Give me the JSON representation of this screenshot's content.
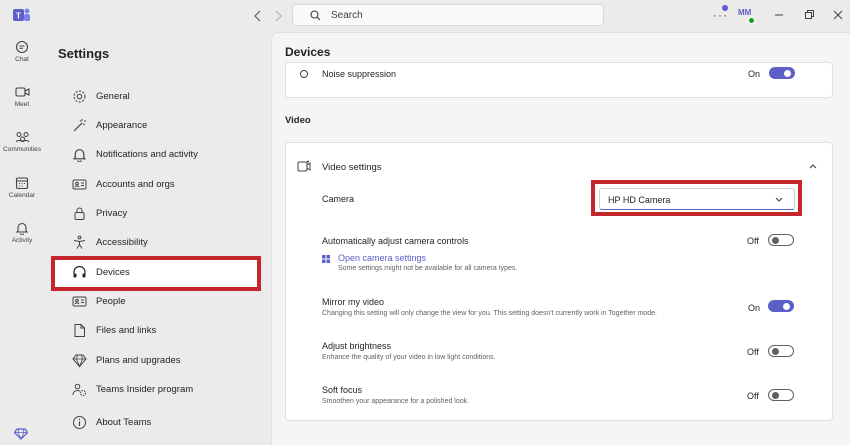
{
  "app": {
    "title": "Microsoft Teams",
    "accent": "#5b5fc7",
    "highlight": "#c4262e"
  },
  "rail": {
    "items": [
      {
        "label": "Chat",
        "icon": "chat-icon"
      },
      {
        "label": "Meet",
        "icon": "video-icon"
      },
      {
        "label": "Communities",
        "icon": "communities-icon"
      },
      {
        "label": "Calendar",
        "icon": "calendar-icon"
      },
      {
        "label": "Activity",
        "icon": "bell-icon"
      }
    ]
  },
  "titlebar": {
    "search_placeholder": "Search",
    "avatar_initials": "MM",
    "more_label": "···"
  },
  "settings": {
    "title": "Settings",
    "items": [
      {
        "label": "General",
        "icon": "gear-icon"
      },
      {
        "label": "Appearance",
        "icon": "wand-icon"
      },
      {
        "label": "Notifications and activity",
        "icon": "bell-icon"
      },
      {
        "label": "Accounts and orgs",
        "icon": "id-card-icon"
      },
      {
        "label": "Privacy",
        "icon": "lock-icon"
      },
      {
        "label": "Accessibility",
        "icon": "accessibility-icon"
      },
      {
        "label": "Devices",
        "icon": "headset-icon",
        "selected": true
      },
      {
        "label": "People",
        "icon": "contact-card-icon"
      },
      {
        "label": "Files and links",
        "icon": "file-icon"
      },
      {
        "label": "Plans and upgrades",
        "icon": "diamond-icon"
      },
      {
        "label": "Teams Insider program",
        "icon": "people-gear-icon"
      },
      {
        "label": "About Teams",
        "icon": "info-icon"
      }
    ]
  },
  "main": {
    "heading": "Devices",
    "noise": {
      "label": "Noise suppression",
      "state": "On"
    },
    "video_section": "Video",
    "video_settings": {
      "title": "Video settings",
      "camera_label": "Camera",
      "camera_value": "HP HD Camera",
      "auto_adjust": {
        "label": "Automatically adjust camera controls",
        "state": "Off"
      },
      "open_camera_link": "Open camera settings",
      "open_camera_note": "Some settings might not be available for all camera types.",
      "mirror": {
        "label": "Mirror my video",
        "desc": "Changing this setting will only change the view for you. This setting doesn't currently work in Together mode.",
        "state": "On"
      },
      "brightness": {
        "label": "Adjust brightness",
        "desc": "Enhance the quality of your video in low light conditions.",
        "state": "Off"
      },
      "soft_focus": {
        "label": "Soft focus",
        "desc": "Smoothen your appearance for a polished look.",
        "state": "Off"
      }
    }
  }
}
